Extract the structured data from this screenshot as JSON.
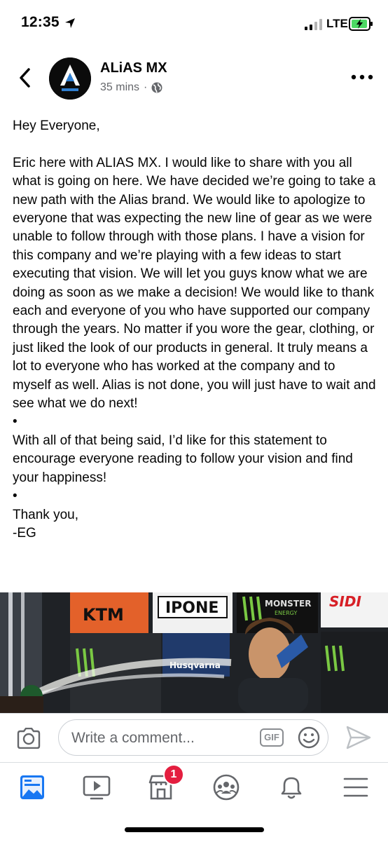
{
  "status_bar": {
    "time": "12:35",
    "network": "LTE",
    "icons": [
      "location-arrow-icon",
      "signal-icon",
      "battery-charging-icon"
    ]
  },
  "post": {
    "page_name": "ALiAS MX",
    "time_ago": "35 mins",
    "separator": "·",
    "privacy_icon": "globe-icon",
    "paragraphs": [
      "Hey Everyone,",
      "",
      "Eric here with ALIAS MX. I would like to share with you all what is going on here. We have decided we’re going to take a new path with the Alias brand.  We would like to apologize to everyone that was expecting the new line of gear as we were unable to follow through with those plans. I have a vision for this company and we’re playing with a few ideas to start executing that vision.  We will let you guys know what we are doing as soon as we make a decision! We would like to thank each and everyone of you who have supported our company through the years. No matter if you wore the gear, clothing, or just liked the look of our products in general. It truly means a lot to everyone who has worked at the company and to myself as well. Alias is not done, you will just have to wait and see what we do next!",
      "•",
      "With all of that being said, I’d like for this statement to encourage everyone reading to follow your vision and find your happiness!",
      "•",
      "Thank you,",
      "-EG"
    ],
    "photo": {
      "banner_texts": [
        "IPONE",
        "MONSTER",
        "ENERGY",
        "SIDI",
        "KTM",
        "Husqvarna"
      ]
    }
  },
  "comment_bar": {
    "placeholder": "Write a comment...",
    "gif_label": "GIF"
  },
  "tab_bar": {
    "items": [
      "news-feed-icon",
      "watch-icon",
      "marketplace-icon",
      "groups-icon",
      "notifications-icon",
      "menu-icon"
    ],
    "marketplace_badge": "1"
  },
  "colors": {
    "accent": "#1877f2",
    "badge": "#e41e3f",
    "secondary_text": "#65676b"
  }
}
